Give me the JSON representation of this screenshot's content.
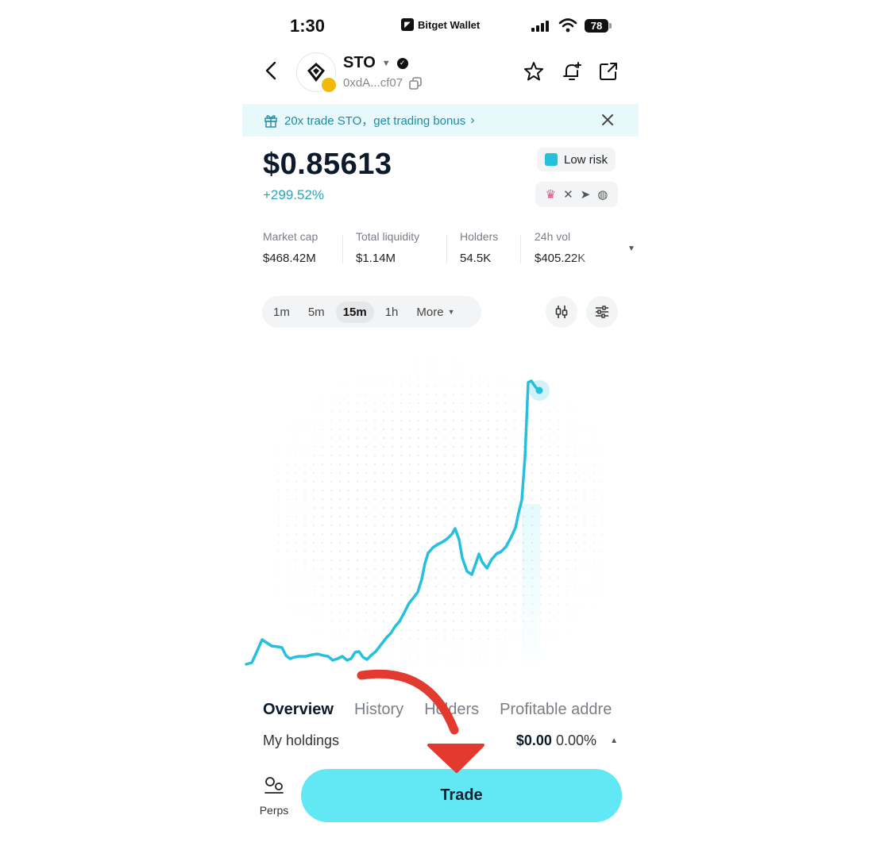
{
  "status_bar": {
    "time": "1:30",
    "carrier": "Bitget Wallet",
    "battery": "78"
  },
  "header": {
    "symbol": "STO",
    "address": "0xdA...cf07"
  },
  "banner": {
    "text": "20x trade STO，get trading bonus"
  },
  "price": {
    "value": "$0.85613",
    "change": "+299.52%"
  },
  "risk": {
    "label": "Low risk"
  },
  "stats": [
    {
      "label": "Market cap",
      "value": "$468.42M"
    },
    {
      "label": "Total liquidity",
      "value": "$1.14M"
    },
    {
      "label": "Holders",
      "value": "54.5K"
    },
    {
      "label": "24h vol",
      "value": "$405.22K"
    }
  ],
  "intervals": {
    "items": [
      "1m",
      "5m",
      "15m",
      "1h"
    ],
    "active": "15m",
    "more": "More"
  },
  "tabs": [
    "Overview",
    "History",
    "Holders",
    "Profitable addre"
  ],
  "holdings": {
    "label": "My holdings",
    "value": "$0.00",
    "percent": "0.00%"
  },
  "bottom": {
    "perps_label": "Perps",
    "trade_label": "Trade"
  },
  "colors": {
    "accent": "#62e8f5",
    "line": "#25c0dd",
    "banner": "#e8f9fb",
    "arrow": "#e23a2e"
  }
}
